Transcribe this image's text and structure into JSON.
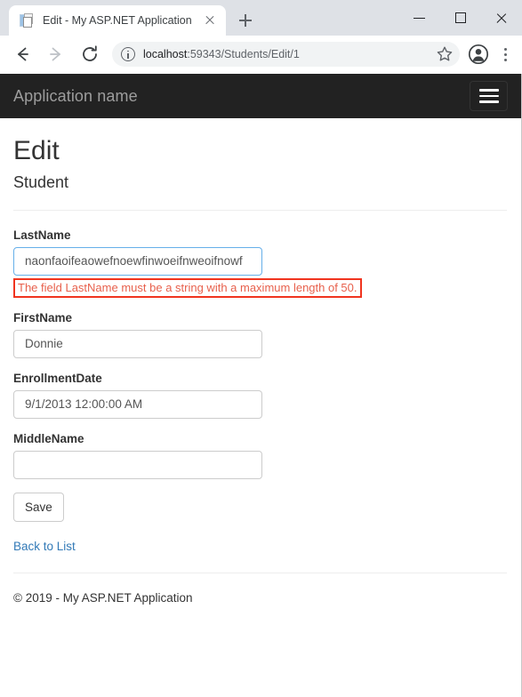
{
  "browser": {
    "tab": {
      "title": "Edit - My ASP.NET Application",
      "favicon_name": "document-favicon",
      "close_label": "Close tab"
    },
    "new_tab_label": "New Tab",
    "window_controls": {
      "minimize": "Minimize",
      "maximize": "Maximize",
      "close": "Close"
    },
    "toolbar": {
      "back": "Back",
      "forward": "Forward",
      "reload": "Reload",
      "bookmark": "Bookmark this page",
      "profile": "Profile",
      "menu": "Customize and control Google Chrome"
    },
    "omnibox": {
      "site_info": "View site information",
      "url_host": "localhost",
      "url_path": ":59343/Students/Edit/1",
      "url_full": "localhost:59343/Students/Edit/1"
    }
  },
  "navbar": {
    "brand": "Application name",
    "toggle_label": "Toggle navigation"
  },
  "page": {
    "title": "Edit",
    "subtitle": "Student",
    "fields": [
      {
        "id": "lastname",
        "label": "LastName",
        "value": "naonfaoifeaowefnoewfinwoeifnweoifnowf",
        "error": "The field LastName must be a string with a maximum length of 50."
      },
      {
        "id": "firstname",
        "label": "FirstName",
        "value": "Donnie",
        "error": ""
      },
      {
        "id": "enrollmentdate",
        "label": "EnrollmentDate",
        "value": "9/1/2013 12:00:00 AM",
        "error": ""
      },
      {
        "id": "middlename",
        "label": "MiddleName",
        "value": "",
        "error": ""
      }
    ],
    "save_label": "Save",
    "back_link": "Back to List",
    "footer": "© 2019 - My ASP.NET Application"
  },
  "colors": {
    "navbar_bg": "#222222",
    "brand_text": "#9d9d9d",
    "error_border": "#f0341f",
    "error_text": "#e8604c",
    "link": "#337ab7",
    "focus_border": "#66afe9",
    "chrome_titlebar": "#dee1e6",
    "omnibox_bg": "#f1f3f4"
  }
}
